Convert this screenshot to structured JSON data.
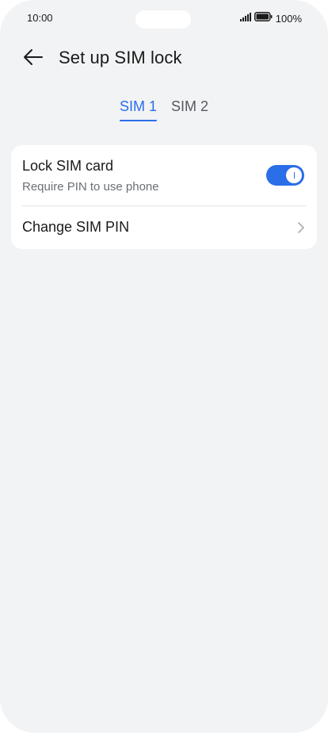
{
  "status_bar": {
    "time": "10:00",
    "battery": "100%"
  },
  "header": {
    "title": "Set up SIM lock"
  },
  "tabs": [
    {
      "label": "SIM 1",
      "active": true
    },
    {
      "label": "SIM 2",
      "active": false
    }
  ],
  "settings": {
    "lock_sim": {
      "title": "Lock SIM card",
      "subtitle": "Require PIN to use phone",
      "enabled": true
    },
    "change_pin": {
      "title": "Change SIM PIN"
    }
  },
  "colors": {
    "accent": "#2a6ee8",
    "background": "#f2f3f5",
    "card": "#ffffff"
  },
  "icons": {
    "back": "back-arrow-icon",
    "chevron": "chevron-right-icon",
    "signal": "signal-icon",
    "battery": "battery-icon"
  }
}
